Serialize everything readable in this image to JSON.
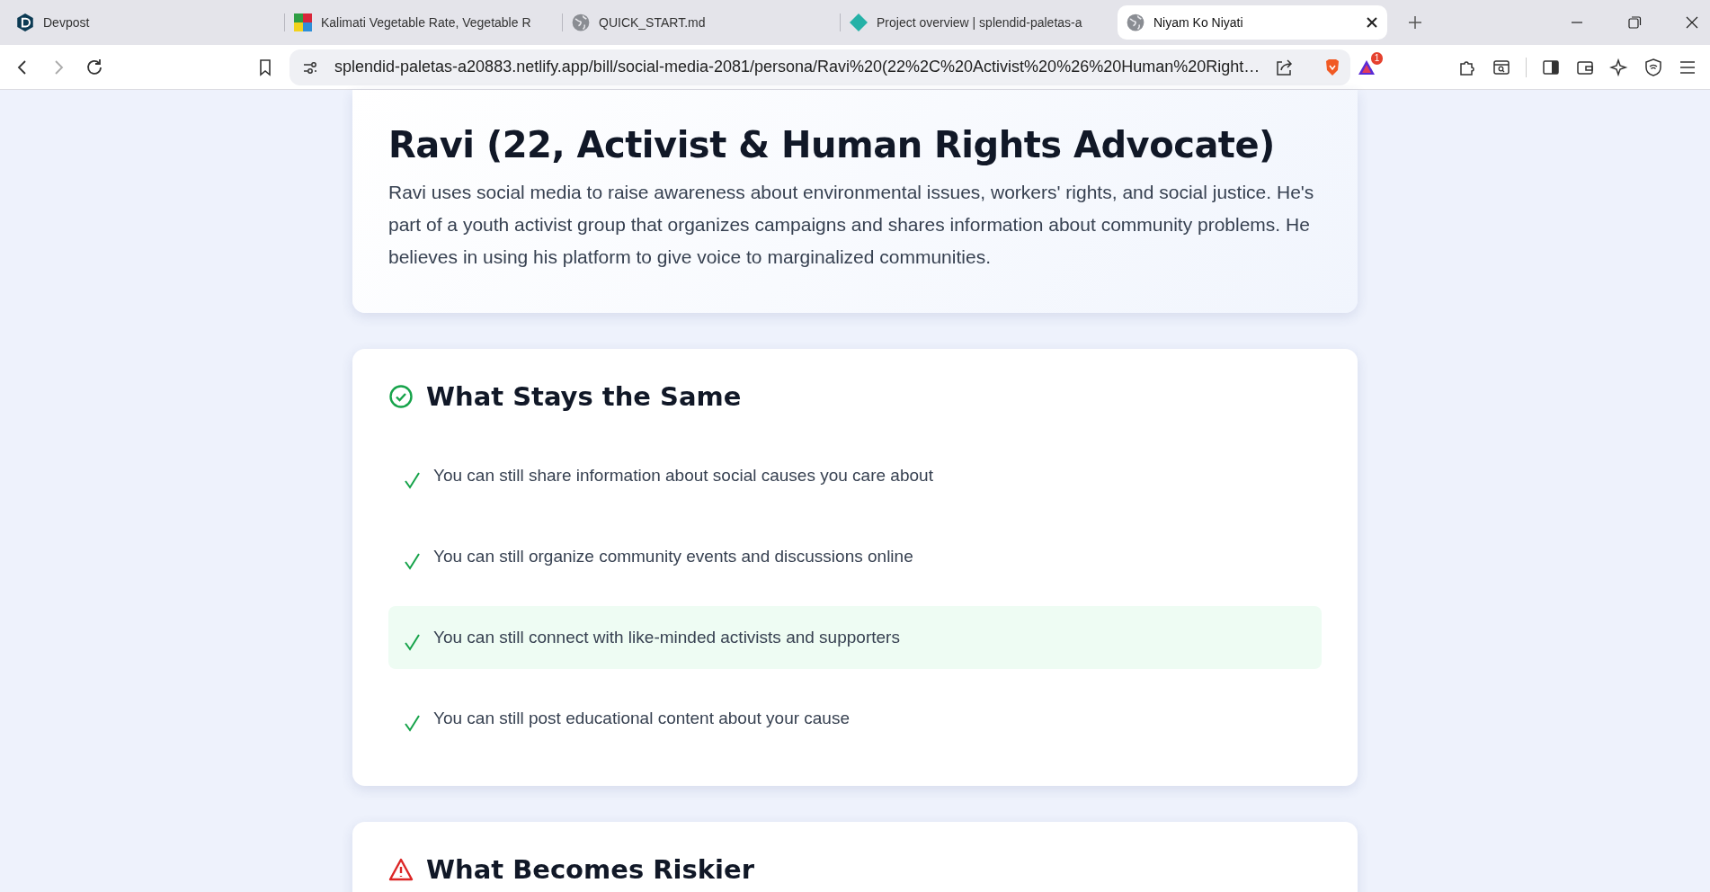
{
  "browser": {
    "tabs": [
      {
        "title": "Devpost",
        "selected": false
      },
      {
        "title": "Kalimati Vegetable Rate, Vegetable R",
        "selected": false
      },
      {
        "title": "QUICK_START.md",
        "selected": false
      },
      {
        "title": "Project overview | splendid-paletas-a",
        "selected": false
      },
      {
        "title": "Niyam Ko Niyati",
        "selected": true
      }
    ],
    "url": "splendid-paletas-a20883.netlify.app/bill/social-media-2081/persona/Ravi%20(22%2C%20Activist%20%26%20Human%20Right…",
    "shield_badge": "1"
  },
  "persona": {
    "title": "Ravi (22, Activist & Human Rights Advocate)",
    "description": "Ravi uses social media to raise awareness about environmental issues, workers' rights, and social justice. He's part of a youth activist group that organizes campaigns and shares information about community problems. He believes in using his platform to give voice to marginalized communities."
  },
  "sections": [
    {
      "kind": "same",
      "heading": "What Stays the Same",
      "items": [
        {
          "text": "You can still share information about social causes you care about",
          "highlighted": false
        },
        {
          "text": "You can still organize community events and discussions online",
          "highlighted": false
        },
        {
          "text": "You can still connect with like-minded activists and supporters",
          "highlighted": true
        },
        {
          "text": "You can still post educational content about your cause",
          "highlighted": false
        }
      ]
    },
    {
      "kind": "riskier",
      "heading": "What Becomes Riskier"
    }
  ]
}
